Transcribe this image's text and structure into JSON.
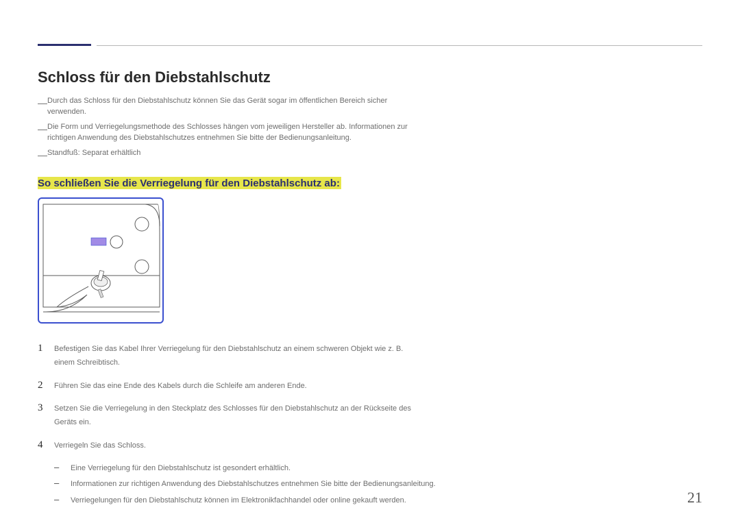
{
  "heading": "Schloss für den Diebstahlschutz",
  "notes": [
    "Durch das Schloss für den Diebstahlschutz können Sie das Gerät sogar im öffentlichen Bereich sicher verwenden.",
    "Die Form und Verriegelungsmethode des Schlosses hängen vom jeweiligen Hersteller ab. Informationen zur richtigen Anwendung des Diebstahlschutzes entnehmen Sie bitte der Bedienungsanleitung.",
    "Standfuß: Separat erhältlich"
  ],
  "subheading": "So schließen Sie die Verriegelung für den Diebstahlschutz ab:",
  "steps": [
    {
      "num": "1",
      "text": "Befestigen Sie das Kabel Ihrer Verriegelung für den Diebstahlschutz an einem schweren Objekt wie z. B. einem Schreibtisch."
    },
    {
      "num": "2",
      "text": "Führen Sie das eine Ende des Kabels durch die Schleife am anderen Ende."
    },
    {
      "num": "3",
      "text": "Setzen Sie die Verriegelung in den Steckplatz des Schlosses für den Diebstahlschutz an der Rückseite des Geräts ein."
    },
    {
      "num": "4",
      "text": "Verriegeln Sie das Schloss."
    }
  ],
  "subnotes": [
    "Eine Verriegelung für den Diebstahlschutz ist gesondert erhältlich.",
    "Informationen zur richtigen Anwendung des Diebstahlschutzes entnehmen Sie bitte der Bedienungsanleitung.",
    "Verriegelungen für den Diebstahlschutz können im Elektronikfachhandel oder online gekauft werden."
  ],
  "pageNumber": "21"
}
